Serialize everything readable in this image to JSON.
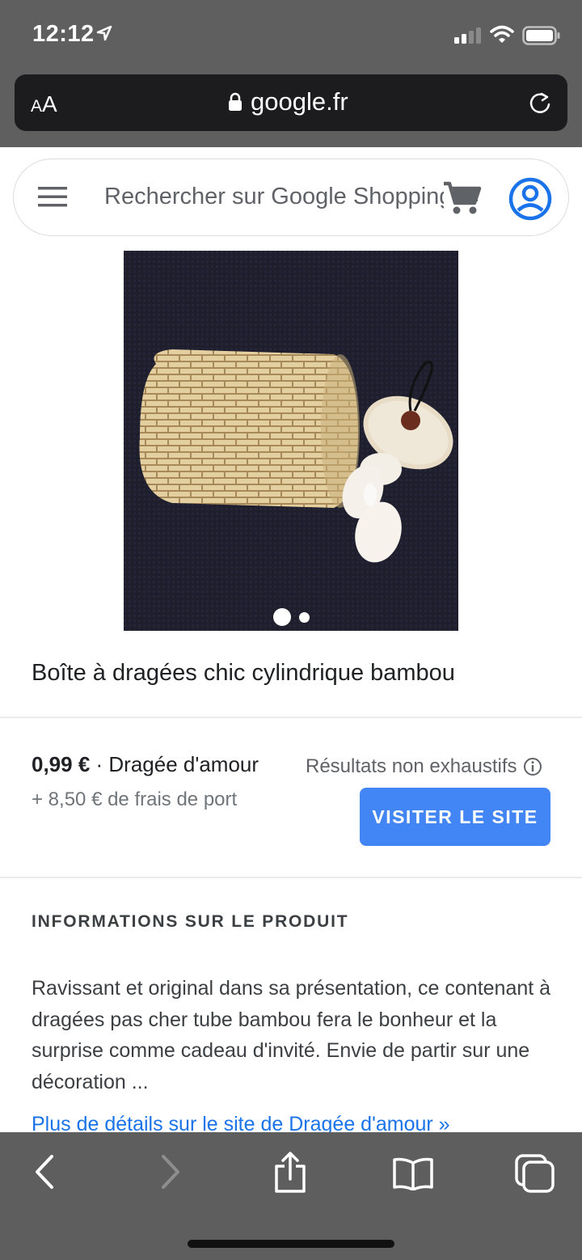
{
  "status_bar": {
    "time": "12:12"
  },
  "url_bar": {
    "text_size_label_small": "A",
    "text_size_label_big": "A",
    "domain": "google.fr"
  },
  "search": {
    "placeholder": "Rechercher sur Google Shopping"
  },
  "product": {
    "title": "Boîte à dragées chic cylindrique bambou",
    "image_count": 2,
    "active_image": 1,
    "price": "0,99 €",
    "separator": " · ",
    "seller": "Dragée d'amour",
    "shipping": "+ 8,50 € de frais de port",
    "results_note": "Résultats non exhaustifs",
    "visit_button": "VISITER LE SITE"
  },
  "info": {
    "heading": "INFORMATIONS SUR LE PRODUIT",
    "description": "Ravissant et original dans sa présentation, ce contenant à dragées pas cher tube bambou fera le bonheur et la surprise comme cadeau d'invité. Envie de partir sur une décoration ...",
    "more_link": "Plus de détails sur le site de Dragée d'amour »"
  },
  "colors": {
    "accent": "#4285f4",
    "account_icon": "#1a73e8",
    "link": "#1a73e8",
    "chrome": "#5f5f5f"
  }
}
